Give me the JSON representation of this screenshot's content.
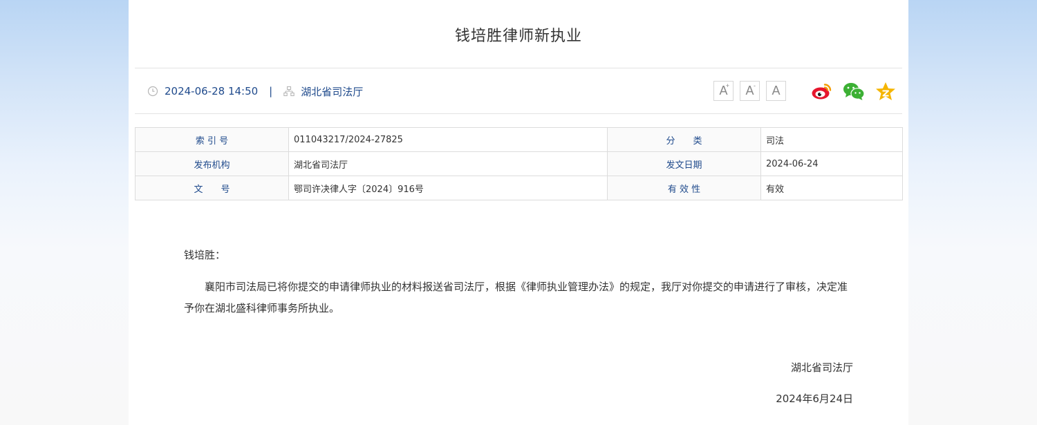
{
  "article": {
    "title": "钱培胜律师新执业",
    "datetime": "2024-06-28 14:50",
    "separator": "|",
    "source": "湖北省司法厅"
  },
  "tools": {
    "font_large": "A",
    "font_large_mark": "+",
    "font_small": "A",
    "font_small_mark": "-",
    "font_default": "A",
    "share_icons": [
      "weibo-icon",
      "wechat-icon",
      "qzone-icon"
    ]
  },
  "info_table": [
    {
      "k1": "索 引 号",
      "v1": "011043217/2024-27825",
      "k2": "分　　类",
      "v2": "司法"
    },
    {
      "k1": "发布机构",
      "v1": "湖北省司法厅",
      "k2": "发文日期",
      "v2": "2024-06-24"
    },
    {
      "k1": "文　　号",
      "v1": "鄂司许决律人字〔2024〕916号",
      "k2": "有 效 性",
      "v2": "有效"
    }
  ],
  "content": {
    "greeting": "钱培胜：",
    "paragraph": "襄阳市司法局已将你提交的申请律师执业的材料报送省司法厅，根据《律师执业管理办法》的规定，我厅对你提交的申请进行了审核，决定准予你在湖北盛科律师事务所执业。",
    "signature_org": "湖北省司法厅",
    "signature_date": "2024年6月24日"
  },
  "colors": {
    "accent": "#1f4a8c",
    "weibo": "#e6162d",
    "wechat": "#3cb034",
    "star": "#f5b500"
  }
}
